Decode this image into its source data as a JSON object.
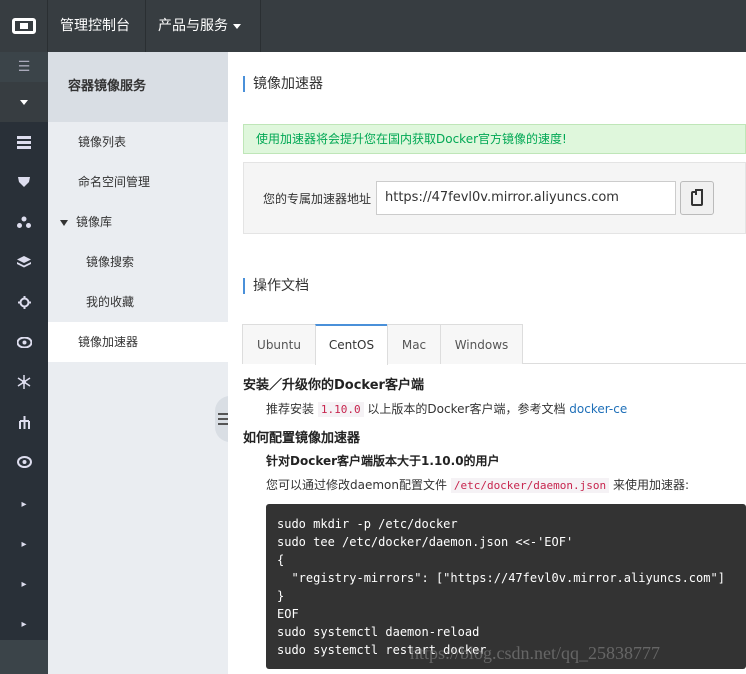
{
  "topbar": {
    "console_label": "管理控制台",
    "products_label": "产品与服务"
  },
  "rail": {
    "menu_glyph": "☰",
    "icons": [
      "server-icon",
      "gift-icon",
      "network-icon",
      "layers-icon",
      "gear-icon",
      "eye-icon",
      "hub-icon",
      "tree-icon",
      "cloud-icon"
    ],
    "arrow_glyph": "▸"
  },
  "subnav": {
    "title": "容器镜像服务",
    "items": [
      {
        "label": "镜像列表"
      },
      {
        "label": "命名空间管理"
      },
      {
        "label": "镜像库"
      },
      {
        "label": "镜像搜索"
      },
      {
        "label": "我的收藏"
      },
      {
        "label": "镜像加速器"
      }
    ]
  },
  "main": {
    "accelerator_title": "镜像加速器",
    "notice": "使用加速器将会提升您在国内获取Docker官方镜像的速度!",
    "address_label": "您的专属加速器地址",
    "address_value": "https://47fevl0v.mirror.aliyuncs.com",
    "docs_title": "操作文档",
    "tabs": [
      "Ubuntu",
      "CentOS",
      "Mac",
      "Windows"
    ],
    "active_tab": "CentOS",
    "install_heading": "安装／升级你的Docker客户端",
    "recommend": {
      "prefix": "推荐安装",
      "version": "1.10.0",
      "middle": "以上版本的Docker客户端，参考文档",
      "link": "docker-ce"
    },
    "config_heading": "如何配置镜像加速器",
    "config_sub": "针对Docker客户端版本大于1.10.0的用户",
    "modify": {
      "prefix": "您可以通过修改daemon配置文件",
      "path": "/etc/docker/daemon.json",
      "suffix": "来使用加速器:"
    },
    "code_lines": [
      "sudo mkdir -p /etc/docker",
      "sudo tee /etc/docker/daemon.json <<-'EOF'",
      "{",
      "  \"registry-mirrors\": [\"https://47fevl0v.mirror.aliyuncs.com\"]",
      "}",
      "EOF",
      "sudo systemctl daemon-reload",
      "sudo systemctl restart docker"
    ]
  },
  "watermark": "https://blog.csdn.net/qq_25838777"
}
